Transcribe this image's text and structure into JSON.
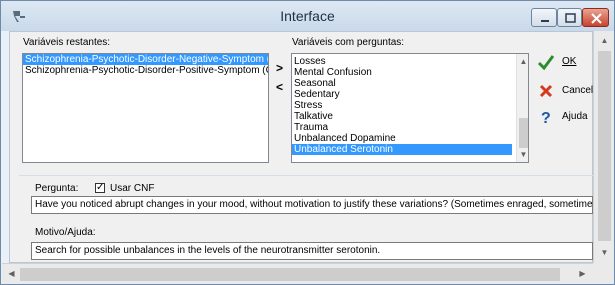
{
  "window": {
    "title": "Interface"
  },
  "left_panel": {
    "label": "Variáveis restantes:",
    "items": [
      {
        "text": "Schizophrenia-Psychotic-Disorder-Negative-Symptom (",
        "selected": true
      },
      {
        "text": "Schizophrenia-Psychotic-Disorder-Positive-Symptom (C",
        "selected": false
      }
    ]
  },
  "transfer": {
    "add_label": ">",
    "remove_label": "<"
  },
  "right_panel": {
    "label": "Variáveis com perguntas:",
    "items": [
      {
        "text": "Losses",
        "selected": false
      },
      {
        "text": "Mental Confusion",
        "selected": false
      },
      {
        "text": "Seasonal",
        "selected": false
      },
      {
        "text": "Sedentary",
        "selected": false
      },
      {
        "text": "Stress",
        "selected": false
      },
      {
        "text": "Talkative",
        "selected": false
      },
      {
        "text": "Trauma",
        "selected": false
      },
      {
        "text": "Unbalanced Dopamine",
        "selected": false
      },
      {
        "text": "Unbalanced Serotonin",
        "selected": true
      }
    ]
  },
  "buttons": {
    "ok": "OK",
    "cancel": "Cancela",
    "help": "Ajuda"
  },
  "question": {
    "label": "Pergunta:",
    "checkbox_label": "Usar CNF",
    "checkbox_checked": true,
    "text": "Have you noticed abrupt changes in your mood, without motivation to justify these variations? (Sometimes enraged, sometimes quiet"
  },
  "reason": {
    "label": "Motivo/Ajuda:",
    "text": "Search for possible unbalances in the levels of the neurotransmitter serotonin."
  },
  "colors": {
    "selection": "#3399ff",
    "ok_check": "#2e8b2e",
    "cancel_x": "#d23a1f",
    "help_q": "#1f56a8"
  }
}
